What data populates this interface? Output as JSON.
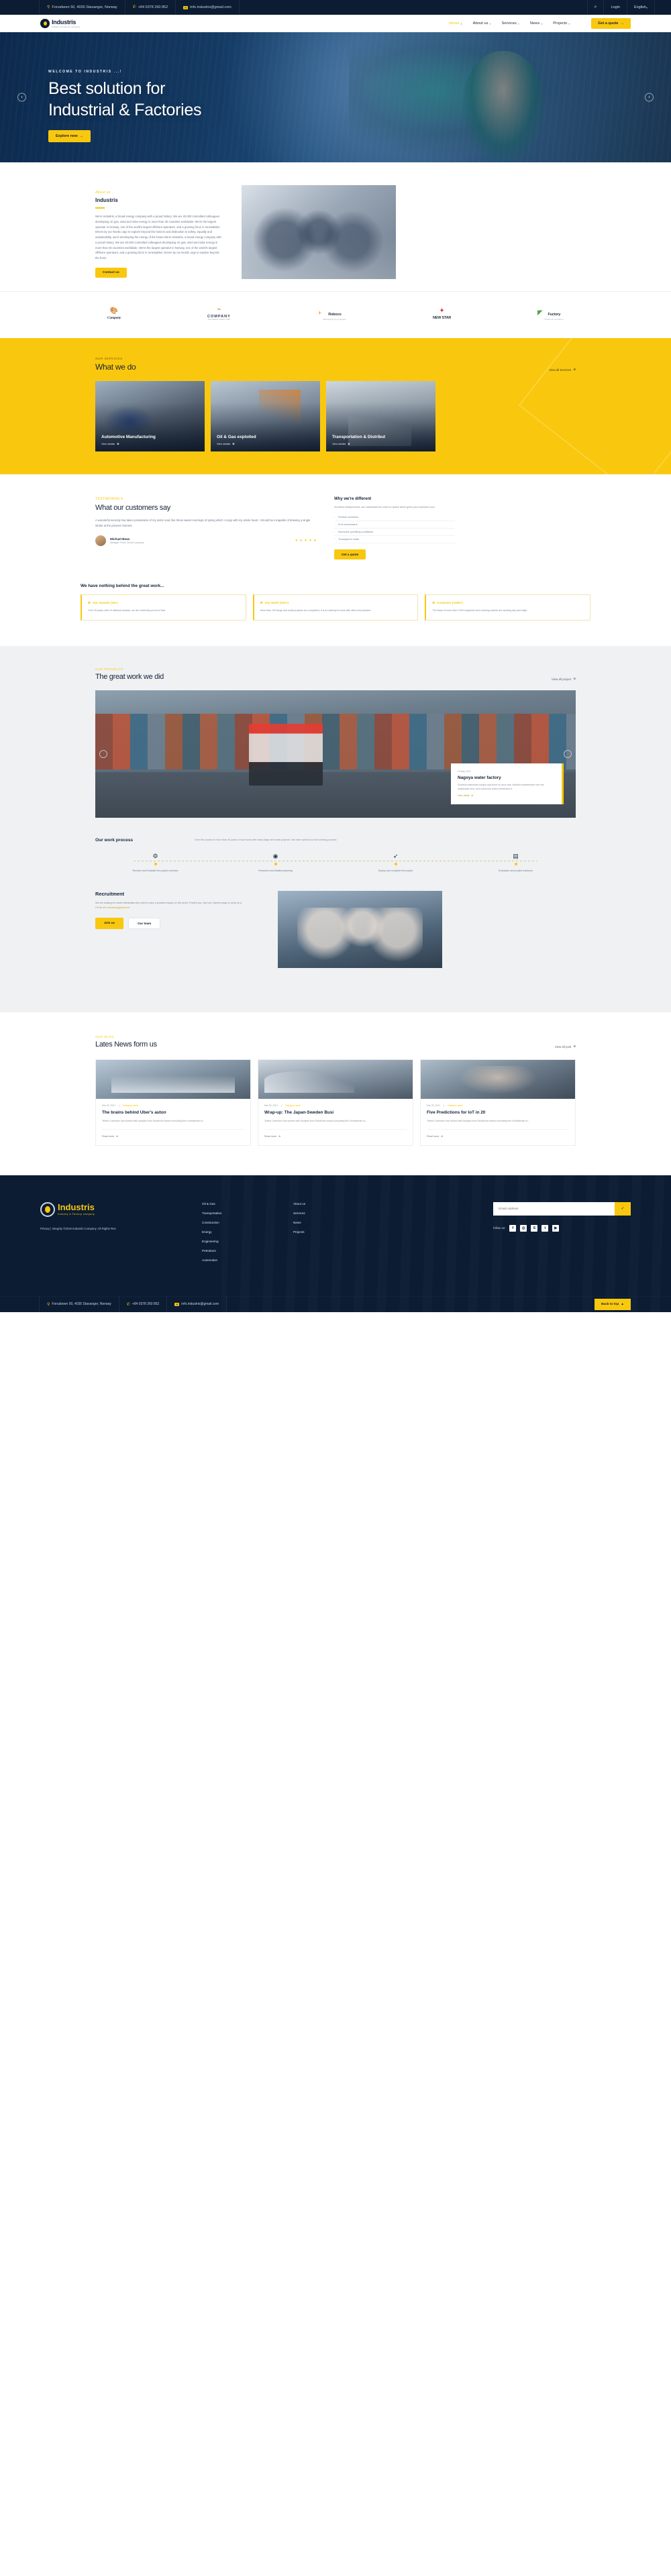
{
  "topbar": {
    "address": "Forusbeen 50, 4035 Stavanger, Norway",
    "phone": "+84 0378 260 852",
    "email": "info.industris@gmail.com",
    "search_icon": "search-icon",
    "login": "Login",
    "language": "English"
  },
  "brand": {
    "name": "Industris",
    "tagline": "Industry & Factory company"
  },
  "nav": {
    "items": [
      {
        "label": "Home",
        "has_caret": true,
        "active": true
      },
      {
        "label": "About us",
        "has_caret": true,
        "active": false
      },
      {
        "label": "Services",
        "has_caret": true,
        "active": false
      },
      {
        "label": "News",
        "has_caret": true,
        "active": false
      },
      {
        "label": "Projects",
        "has_caret": true,
        "active": false
      }
    ],
    "cta": "Get a quote"
  },
  "hero": {
    "eyebrow": "WELCOME TO INDUSTRIS ...!",
    "title_line1": "Best solution for",
    "title_line2": "Industrial & Factories",
    "button": "Explore now",
    "prev_icon": "chevron-left-icon",
    "next_icon": "chevron-right-icon"
  },
  "about": {
    "eyebrow": "About us",
    "title": "Industris",
    "paragraph": "We're Industris, a broad energy company with a proud history. We are 20.000 committed colleagues developing oil, gas, wind and solar energy in more than 30 countries worldwide. We're the largest operator in Norway, one of the world's largest offshore operators, and a growing force in renewables. Driven by our Nordic urge to explore beyond the horizon and dedication to safety, equality and sustainability, we're developing the energy of the future.We're Industris, a broad energy company with a proud history. We are 20.000 committed colleagues developing oil, gas, wind and solar energy in more than 30 countries worldwide. We're the largest operator in Norway, one of the world's largest offshore operators, and a growing force in renewables. Driven by our Nordic urge to explore beyond the horiz.",
    "button": "Contact us"
  },
  "clients": [
    {
      "mark": "clover-logo-icon",
      "name": "Company",
      "tag": ""
    },
    {
      "mark": "arrow-logo-icon",
      "name": "COMPANY",
      "tag": "TAILORED SINCE 2020"
    },
    {
      "mark": "roboco-logo-icon",
      "name": "Roboco",
      "tag": "Manufacturing Company"
    },
    {
      "mark": "newstar-logo-icon",
      "name": "NEW STAR",
      "tag": "CONSTRUCTION COMPANY"
    },
    {
      "mark": "fuctory-logo-icon",
      "name": "Fuctory",
      "tag": "Industrial & Factory"
    }
  ],
  "whatwedo": {
    "eyebrow": "OUR SERVICES",
    "title": "What we do",
    "link": "View all Services",
    "cards": [
      {
        "title": "Automotive Manufacturing",
        "link": "View details"
      },
      {
        "title": "Oil & Gas exploited",
        "link": "View details"
      },
      {
        "title": "Transportation & Distribut",
        "link": "View details"
      }
    ]
  },
  "testimonial": {
    "eyebrow": "TESTIMONIALS",
    "title": "What our customers say",
    "quote": "A wonderful serenity has taken possession of my entire soul, like these sweet mornings of spring which I enjoy with my whole heart. I should be incapable of drawing a single stroke at the present moment",
    "name": "Michael Bean",
    "role": "Manager, Fedor Techno company",
    "stars": "★ ★ ★ ★ ★",
    "why_title": "Why we're different",
    "why_sub": "As fellow entrepreneurs, we understand the need for space which gives your business room",
    "why_items": [
      "Flexible solutions",
      "Free technicians",
      "Improved operating conditions",
      "Transparent costs"
    ],
    "why_button": "Get a quote"
  },
  "features": {
    "title": "We have nothing behind the great work...",
    "boxes": [
      {
        "heading": "Our Awards (15+)",
        "text": "Over 25 years with 15 different awards, we are extremely proud of that"
      },
      {
        "heading": "Our Work (100+)",
        "text": "More than 100 large and small projects are completed, it is an attempt to work with effort and passion"
      },
      {
        "heading": "Customer (1200+)",
        "text": "The team of more than 1200 engineers and working experts are working day and night"
      }
    ]
  },
  "projects": {
    "eyebrow": "OUR PROJECTS",
    "title": "The great work we did",
    "link": "View all project",
    "card": {
      "date": "23 May 2021",
      "name": "Nagoya water factory",
      "desc": "Vivamus maecenas congue quis tortor eu arcu cras. Nostrud condimentum nec nisi malesuada urna, sem commodo lectus elementum a",
      "more": "View detail"
    },
    "prev_icon": "chevron-left-icon",
    "next_icon": "chevron-right-icon"
  },
  "workprocess": {
    "title": "Our work process",
    "sub": "Over the course of more than 25 years of hard work with many large and small projects. We have worked out the working process",
    "steps": [
      {
        "icon": "gear-icon",
        "label": "Receive and Evaluate the project overview"
      },
      {
        "icon": "compass-icon",
        "label": "Research and detailed planning"
      },
      {
        "icon": "rocket-icon",
        "label": "Deploy and complete the project"
      },
      {
        "icon": "handover-icon",
        "label": "Evaluation and project handover"
      }
    ]
  },
  "recruitment": {
    "title": "Recruitment",
    "text": "We are looking for smart individuals who want to have a positive impact on the world. If that's you, visit our Careers page or send us a",
    "cv_label": "CV at",
    "cv_email": "info.industris@gmail.com",
    "btn_join": "Join us",
    "btn_team": "Our team"
  },
  "news": {
    "eyebrow": "OUR BLOG",
    "title": "Lates News form us",
    "link": "View all post",
    "cards": [
      {
        "date": "Mar 25, 2021",
        "category": "Category name",
        "title": "The brains behind Uber's auton",
        "excerpt": "Tetxtxt Commson has worked with analysis from Stockholm-based consulting firm Northstream to...",
        "read": "Read more"
      },
      {
        "date": "Mar 25, 2021",
        "category": "Category name",
        "title": "Wrap-up: The Japan-Sweden Busi",
        "excerpt": "Tetxtxt Commson has worked with analysis from Stockholm-based consulting firm Northstream to...",
        "read": "Read more"
      },
      {
        "date": "Mar 25, 2021",
        "category": "Category name",
        "title": "Five Predictions for IoT in 20",
        "excerpt": "Tetxtxt Commson has worked with analysis from Stockholm-based consulting firm Northstream to...",
        "read": "Read more"
      }
    ]
  },
  "footer": {
    "copyright": "Privacy | Integrity ©2019 Industris Company. All Rights Res",
    "col1": [
      "Oil & Gas",
      "Transportation",
      "Construction",
      "Energy",
      "Engineering",
      "Petroleum",
      "Automotive"
    ],
    "col2": [
      "About us",
      "Services",
      "News",
      "Projects"
    ],
    "newsletter_placeholder": "Email Address",
    "newsletter_submit": "✓",
    "follow_label": "follow us:",
    "socials": [
      "facebook-icon",
      "instagram-icon",
      "skype-icon",
      "twitter-icon",
      "youtube-icon"
    ],
    "bottom": {
      "address": "Forusbeen 50, 4035 Stavanger, Norway",
      "phone": "+84 0378 260 852",
      "email": "info.industris@gmail.com",
      "back_to_top": "Back to top"
    }
  },
  "colors": {
    "accent": "#f9c80e",
    "dark": "#0b1c33",
    "grey_bg": "#f0f1f3"
  }
}
